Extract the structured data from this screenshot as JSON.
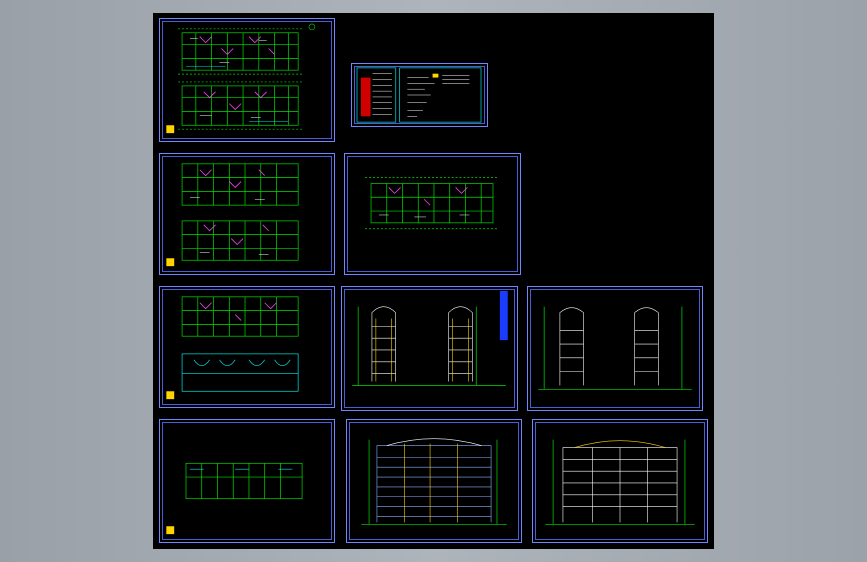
{
  "app": {
    "title": "",
    "background_color": "#000000",
    "frame_color": "#6f86ff"
  },
  "sheets": [
    {
      "id": "plan-1",
      "kind": "floor-plans",
      "icon": "floor-plan-drawing"
    },
    {
      "id": "notes",
      "kind": "design-notes",
      "icon": "notes-table-drawing"
    },
    {
      "id": "plan-2",
      "kind": "floor-plans",
      "icon": "floor-plan-drawing"
    },
    {
      "id": "plan-3",
      "kind": "floor-plan",
      "icon": "floor-plan-drawing"
    },
    {
      "id": "plan-4",
      "kind": "floor-plans",
      "icon": "floor-plan-drawing"
    },
    {
      "id": "section-1",
      "kind": "sections",
      "icon": "section-drawing"
    },
    {
      "id": "section-2",
      "kind": "sections",
      "icon": "section-drawing"
    },
    {
      "id": "plan-5",
      "kind": "floor-plan",
      "icon": "floor-plan-drawing"
    },
    {
      "id": "elevation-1",
      "kind": "elevation",
      "icon": "elevation-drawing"
    },
    {
      "id": "elevation-2",
      "kind": "elevation",
      "icon": "elevation-drawing"
    }
  ]
}
